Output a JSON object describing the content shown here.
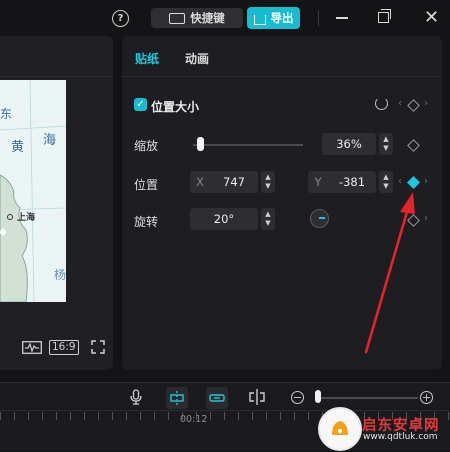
{
  "topbar": {
    "help_icon": "question-circle-icon",
    "shortcut_label": "快捷键",
    "export_label": "导出",
    "accent_color": "#18bcd0"
  },
  "player": {
    "ratio_label": "16:9",
    "map_labels": [
      "黄",
      "海",
      "上海",
      "杨",
      "东"
    ]
  },
  "panel": {
    "tabs": [
      {
        "label": "贴纸",
        "active": true
      },
      {
        "label": "动画",
        "active": false
      }
    ],
    "section": {
      "title": "位置大小",
      "checked": true
    },
    "scale": {
      "label": "缩放",
      "value": "36%",
      "slider_fraction": 0.06
    },
    "position": {
      "label": "位置",
      "x_prefix": "X",
      "x_value": "747",
      "y_prefix": "Y",
      "y_value": "-381",
      "keyframe_active": true
    },
    "rotation": {
      "label": "旋转",
      "value": "20°"
    }
  },
  "timeline": {
    "time_label": "00:12"
  },
  "watermark": {
    "title": "启东安卓网",
    "url": "www.qdtluk.com"
  }
}
